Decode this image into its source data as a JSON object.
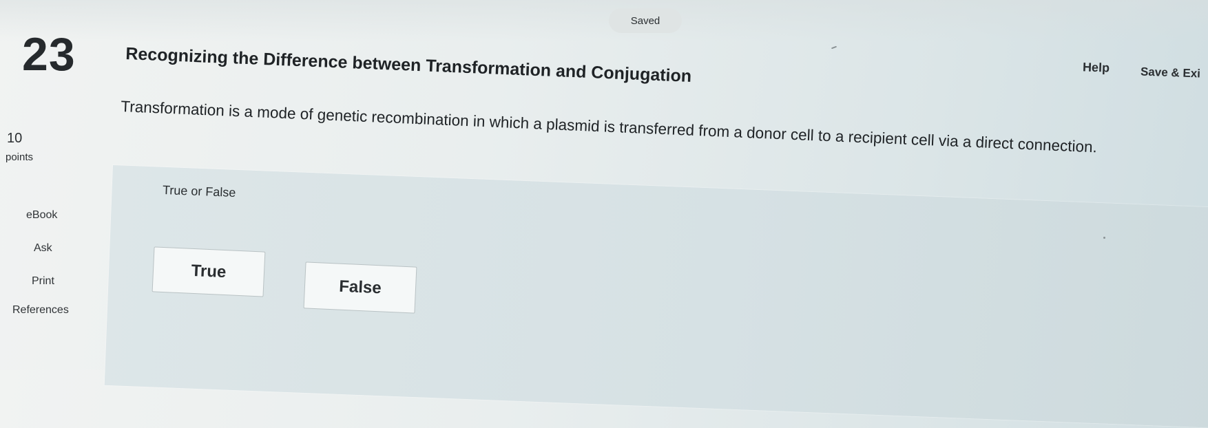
{
  "status": {
    "saved_label": "Saved"
  },
  "header": {
    "help_label": "Help",
    "save_exit_label": "Save & Exi"
  },
  "question": {
    "number": "23",
    "title": "Recognizing the Difference between Transformation and Conjugation",
    "points_value": "10",
    "points_label": "points",
    "text": "Transformation is a mode of genetic recombination in which a plasmid is transferred from a donor cell to a recipient cell via a direct connection.",
    "answer_type": "True or False",
    "choices": [
      {
        "label": "True"
      },
      {
        "label": "False"
      }
    ]
  },
  "sidebar": {
    "items": [
      {
        "label": "eBook"
      },
      {
        "label": "Ask"
      },
      {
        "label": "Print"
      },
      {
        "label": "References"
      }
    ]
  }
}
